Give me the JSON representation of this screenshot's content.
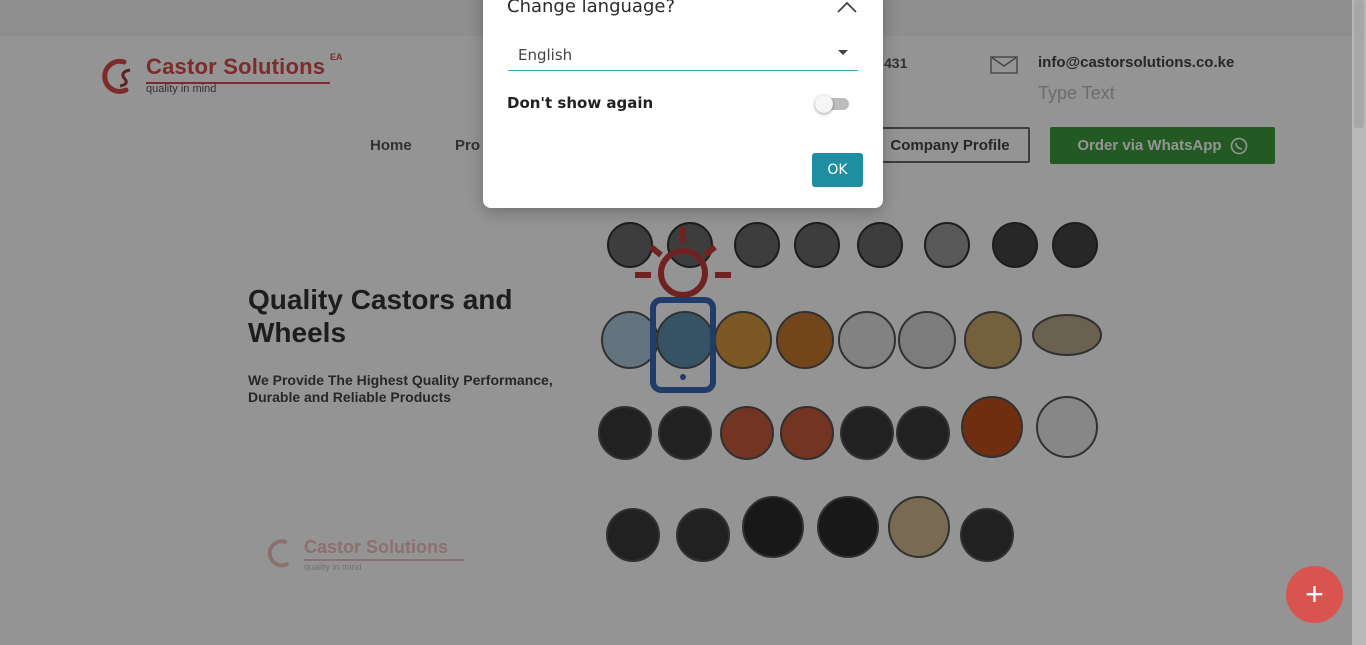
{
  "header": {
    "logo_name": "Castor Solutions",
    "logo_suffix": "EA",
    "logo_tagline": "quality in mind",
    "phone_partial": "431",
    "email": "info@castorsolutions.co.ke",
    "type_text_placeholder": "Type Text"
  },
  "nav": {
    "home": "Home",
    "products_partial": "Pro",
    "company_profile": "Company Profile",
    "order_whatsapp": "Order via WhatsApp"
  },
  "hero": {
    "title": "Quality Castors and Wheels",
    "subtitle": "We Provide The Highest Quality Performance, Durable and Reliable Products"
  },
  "footer_logo": {
    "name": "Castor Solutions",
    "tagline": "quality in mind"
  },
  "fab": {
    "label": "+"
  },
  "dialog": {
    "title": "Change language?",
    "selected_language": "English",
    "dont_show_label": "Don't show again",
    "dont_show_checked": false,
    "ok_label": "OK"
  },
  "colors": {
    "brand_red": "#d84a4a",
    "whatsapp_green": "#3d9b3d",
    "dialog_accent": "#1f8ea0"
  }
}
